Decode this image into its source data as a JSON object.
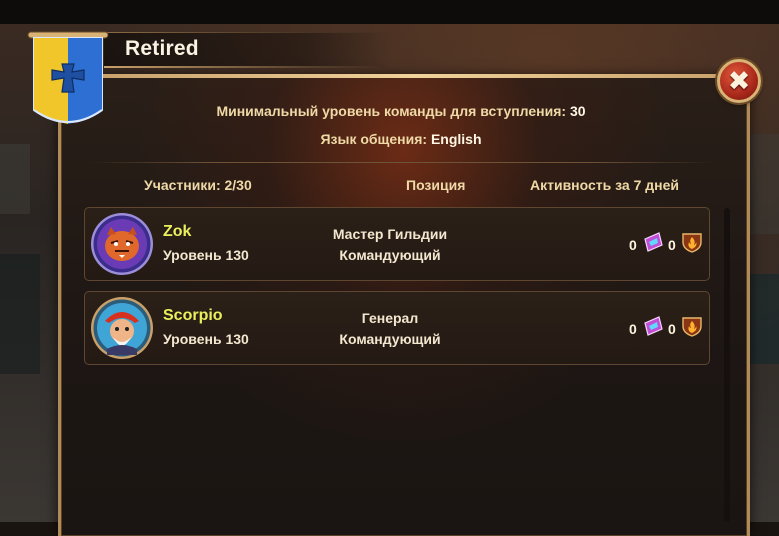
{
  "guild": {
    "title": "Retired",
    "min_level_label": "Минимальный уровень команды для вступления:",
    "min_level_value": "30",
    "language_label": "Язык общения:",
    "language_value": "English"
  },
  "close_button": {
    "label": "✖"
  },
  "columns": {
    "members": "Участники: 2/30",
    "position": "Позиция",
    "activity": "Активность за 7 дней"
  },
  "members": [
    {
      "name": "Zok",
      "level": "Уровень 130",
      "position_line1": "Мастер Гильдии",
      "position_line2": "Командующий",
      "activity_a": "0",
      "activity_b": "0"
    },
    {
      "name": "Scorpio",
      "level": "Уровень 130",
      "position_line1": "Генерал",
      "position_line2": "Командующий",
      "activity_a": "0",
      "activity_b": "0"
    }
  ],
  "colors": {
    "name": "#e9f05c",
    "label": "#efd9a6",
    "frame": "#b08a57",
    "close": "#c3372a"
  },
  "icons": {
    "activity_a": "gem-ticket-icon",
    "activity_b": "fire-shield-icon",
    "banner": "cross-banner-icon",
    "close": "close-icon"
  }
}
